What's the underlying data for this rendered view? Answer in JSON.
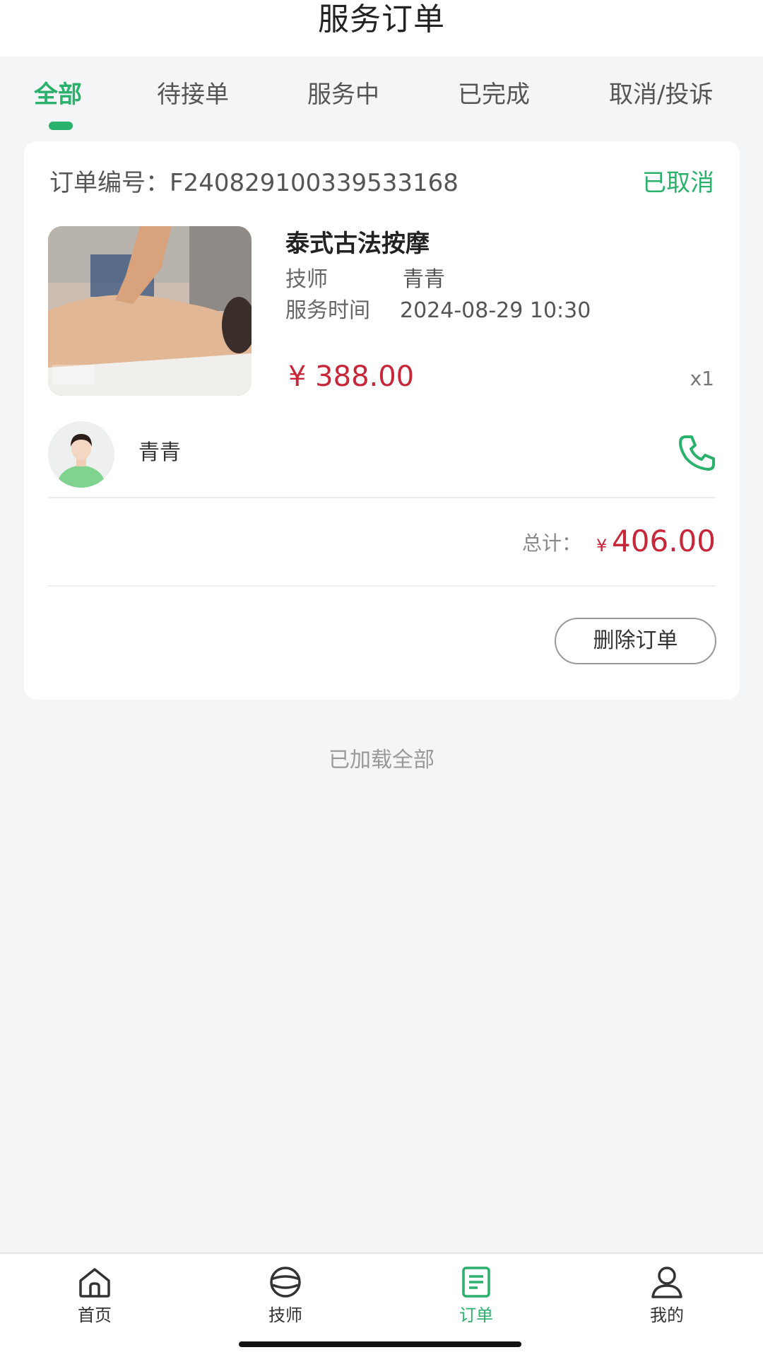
{
  "header": {
    "title": "服务订单"
  },
  "tabs": [
    {
      "label": "全部",
      "active": true
    },
    {
      "label": "待接单",
      "active": false
    },
    {
      "label": "服务中",
      "active": false
    },
    {
      "label": "已完成",
      "active": false
    },
    {
      "label": "取消/投诉",
      "active": false
    }
  ],
  "order": {
    "number_label": "订单编号：",
    "number": "F2408291003395331​68",
    "status": "已取消",
    "service_name": "泰式古法按摩",
    "tech_label": "技师",
    "tech_value": "青青",
    "time_label": "服务时间",
    "time_value": "2024-08-29 10:30",
    "price": "¥ 388.00",
    "quantity": "x1",
    "technician_name": "青青",
    "total_label": "总计：",
    "total_currency": "¥",
    "total_value": "406.00",
    "delete_button": "删除订单"
  },
  "footer_text": "已加载全部",
  "bottom_nav": [
    {
      "label": "首页",
      "icon": "home-icon",
      "active": false
    },
    {
      "label": "技师",
      "icon": "technician-icon",
      "active": false
    },
    {
      "label": "订单",
      "icon": "order-icon",
      "active": true
    },
    {
      "label": "我的",
      "icon": "profile-icon",
      "active": false
    }
  ],
  "colors": {
    "accent": "#2ab16b",
    "price": "#c8273a",
    "background": "#f4f5f7"
  }
}
